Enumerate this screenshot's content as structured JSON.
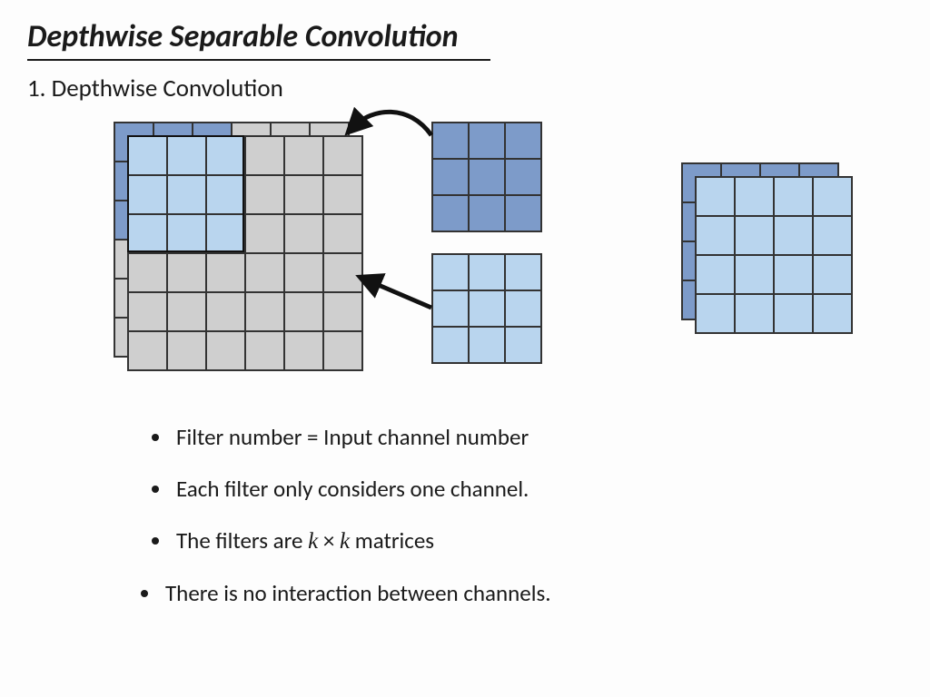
{
  "title": "Depthwise Separable Convolution",
  "subtitle": "1. Depthwise Convolution",
  "bullets": [
    "Filter number = Input channel number",
    "Each filter only considers one channel.",
    "The filters are k × k matrices",
    "There is no interaction between channels."
  ],
  "diagram": {
    "input": {
      "rows": 6,
      "cols": 6,
      "channels": 2,
      "window_rows": 3,
      "window_cols": 3
    },
    "filters": [
      {
        "rows": 3,
        "cols": 3,
        "color": "blue"
      },
      {
        "rows": 3,
        "cols": 3,
        "color": "lightblue"
      }
    ],
    "output": {
      "rows": 4,
      "cols": 4,
      "channels": 2
    }
  }
}
